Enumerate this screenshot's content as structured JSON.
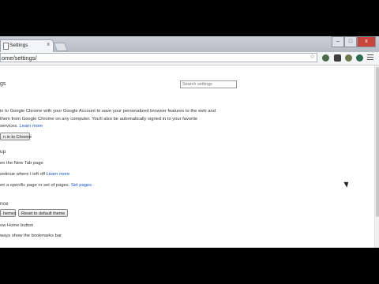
{
  "tab": {
    "title": "Settings",
    "close": "x"
  },
  "window_controls": {
    "minimize": "–",
    "maximize": "□",
    "close": "x"
  },
  "omnibox": {
    "url": "ome/settings/"
  },
  "page": {
    "title": "gs",
    "search_placeholder": "Search settings",
    "signin": {
      "line1": "in to Google Chrome with your Google Account to save your personalized browser features to the web and",
      "line2": "them from Google Chrome on any computer. You'll also be automatically signed in to your favorite",
      "line3": "services.",
      "learn_more": "Learn more",
      "button": "n in to Chrome"
    },
    "startup": {
      "heading": "up",
      "option1": "en the New Tab page",
      "option2": "ontinue where I left off",
      "option2_link": "Learn more",
      "option3": "en a specific page or set of pages.",
      "option3_link": "Set pages"
    },
    "appearance": {
      "heading": "nce",
      "themes_button": "hemes",
      "reset_button": "Reset to default theme",
      "home_button": "ow Home button",
      "bookmarks_bar": "ways show the bookmarks bar"
    }
  }
}
